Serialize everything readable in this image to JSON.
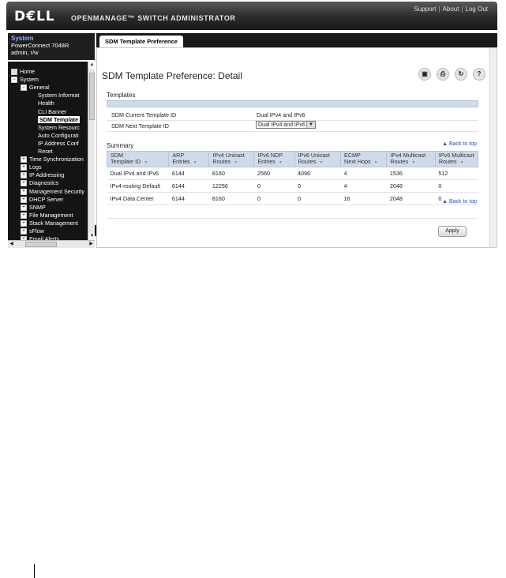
{
  "header": {
    "logo": "D€LL",
    "product": "OPENMANAGE™ SWITCH ADMINISTRATOR",
    "links": [
      "Support",
      "About",
      "Log Out"
    ]
  },
  "system": {
    "title": "System",
    "model": "PowerConnect 7048R",
    "user": "admin, r/w"
  },
  "nav": {
    "items": [
      {
        "label": "Home",
        "toggle": "box",
        "indent": 0
      },
      {
        "label": "System",
        "toggle": "−",
        "indent": 0
      },
      {
        "label": "General",
        "toggle": "−",
        "indent": 1
      },
      {
        "label": "System Informat",
        "toggle": "",
        "indent": 2
      },
      {
        "label": "Health",
        "toggle": "",
        "indent": 2
      },
      {
        "label": "CLI Banner",
        "toggle": "",
        "indent": 2
      },
      {
        "label": "SDM Template",
        "toggle": "",
        "indent": 2,
        "selected": true
      },
      {
        "label": "System Resourc",
        "toggle": "",
        "indent": 2
      },
      {
        "label": "Auto Configurati",
        "toggle": "",
        "indent": 2
      },
      {
        "label": "IP Address Conf",
        "toggle": "",
        "indent": 2
      },
      {
        "label": "Reset",
        "toggle": "",
        "indent": 2
      },
      {
        "label": "Time Synchronization",
        "toggle": "+",
        "indent": 1
      },
      {
        "label": "Logs",
        "toggle": "+",
        "indent": 1
      },
      {
        "label": "IP Addressing",
        "toggle": "+",
        "indent": 1
      },
      {
        "label": "Diagnostics",
        "toggle": "+",
        "indent": 1
      },
      {
        "label": "Management Security",
        "toggle": "+",
        "indent": 1
      },
      {
        "label": "DHCP Server",
        "toggle": "+",
        "indent": 1
      },
      {
        "label": "SNMP",
        "toggle": "+",
        "indent": 1
      },
      {
        "label": "File Management",
        "toggle": "+",
        "indent": 1
      },
      {
        "label": "Stack Management",
        "toggle": "+",
        "indent": 1
      },
      {
        "label": "sFlow",
        "toggle": "+",
        "indent": 1
      },
      {
        "label": "Email Alerts",
        "toggle": "+",
        "indent": 1
      }
    ]
  },
  "tab": {
    "label": "SDM Template Preference"
  },
  "page": {
    "title": "SDM Template Preference: Detail",
    "templates_label": "Templates",
    "current_label": "SDM Current Template ID",
    "current_value": "Dual IPv4 and IPv6",
    "next_label": "SDM Next Template ID",
    "next_value": "Dual IPv4 and IPv6",
    "summary_label": "Summary",
    "back_to_top": "Back to top",
    "apply": "Apply"
  },
  "icons": [
    "save-icon",
    "print-icon",
    "refresh-icon",
    "help-icon"
  ],
  "table": {
    "headers": [
      [
        "SDM",
        "Template ID"
      ],
      [
        "ARP",
        "Entries"
      ],
      [
        "IPv4 Unicast",
        "Routes"
      ],
      [
        "IPv6 NDP",
        "Entries"
      ],
      [
        "IPv6 Unicast",
        "Routes"
      ],
      [
        "ECMP",
        "Next Hops"
      ],
      [
        "IPv4 Multicast",
        "Routes"
      ],
      [
        "IPv6 Multicast",
        "Routes"
      ]
    ],
    "rows": [
      [
        "Dual IPv4 and IPv6",
        "6144",
        "8160",
        "2560",
        "4096",
        "4",
        "1536",
        "512"
      ],
      [
        "IPv4-routing Default",
        "6144",
        "12256",
        "0",
        "0",
        "4",
        "2048",
        "0"
      ],
      [
        "IPv4 Data Center",
        "6144",
        "8160",
        "0",
        "0",
        "16",
        "2048",
        "0"
      ]
    ]
  }
}
